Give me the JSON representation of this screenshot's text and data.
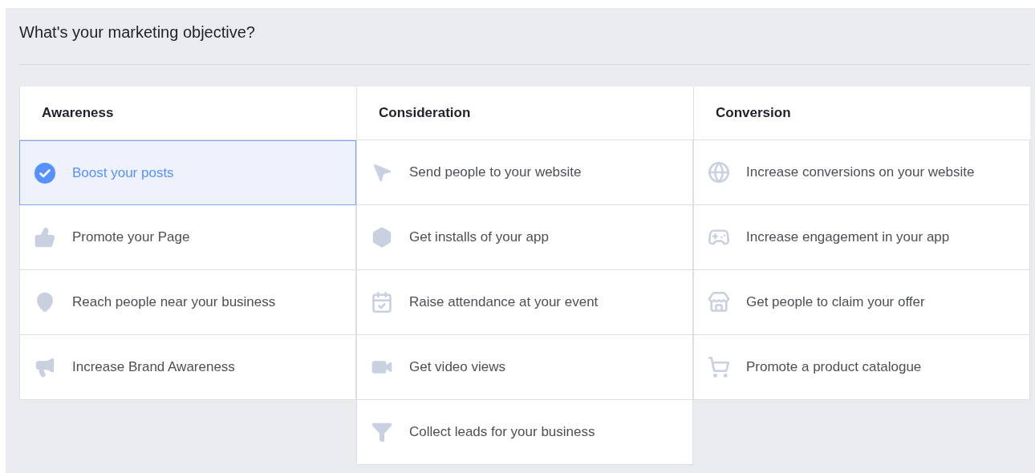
{
  "title": "What's your marketing objective?",
  "columns": [
    {
      "heading": "Awareness",
      "items": [
        {
          "label": "Boost your posts",
          "selected": true
        },
        {
          "label": "Promote your Page",
          "selected": false
        },
        {
          "label": "Reach people near your business",
          "selected": false
        },
        {
          "label": "Increase Brand Awareness",
          "selected": false
        }
      ]
    },
    {
      "heading": "Consideration",
      "items": [
        {
          "label": "Send people to your website",
          "selected": false
        },
        {
          "label": "Get installs of your app",
          "selected": false
        },
        {
          "label": "Raise attendance at your event",
          "selected": false
        },
        {
          "label": "Get video views",
          "selected": false
        },
        {
          "label": "Collect leads for your business",
          "selected": false
        }
      ]
    },
    {
      "heading": "Conversion",
      "items": [
        {
          "label": "Increase conversions on your website",
          "selected": false
        },
        {
          "label": "Increase engagement in your app",
          "selected": false
        },
        {
          "label": "Get people to claim your offer",
          "selected": false
        },
        {
          "label": "Promote a product catalogue",
          "selected": false
        }
      ]
    }
  ]
}
